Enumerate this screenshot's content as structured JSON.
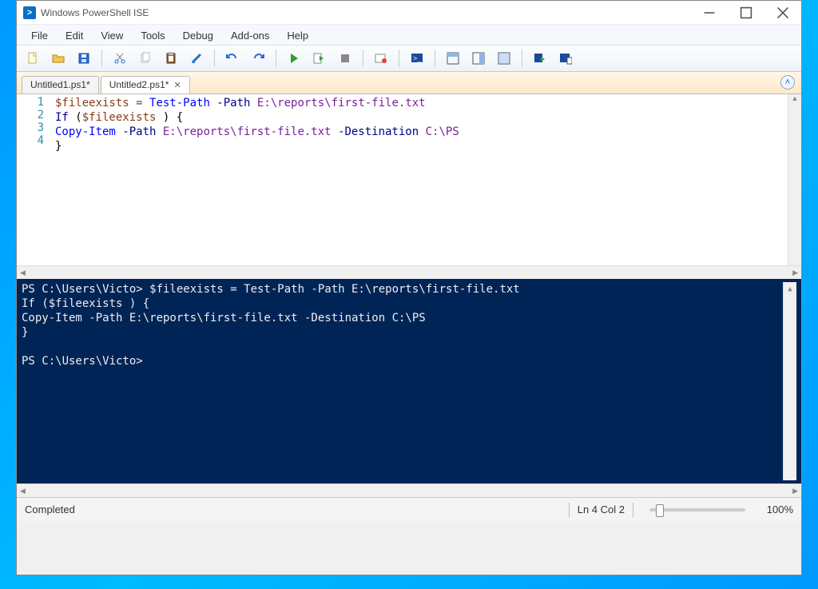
{
  "titlebar": {
    "title": "Windows PowerShell ISE"
  },
  "menus": [
    "File",
    "Edit",
    "View",
    "Tools",
    "Debug",
    "Add-ons",
    "Help"
  ],
  "toolbar_icons": [
    "new-file-icon",
    "open-file-icon",
    "save-icon",
    "sep",
    "cut-icon",
    "copy-icon",
    "paste-icon",
    "clear-icon",
    "sep",
    "undo-icon",
    "redo-icon",
    "sep",
    "run-script-icon",
    "run-selection-icon",
    "stop-icon",
    "sep",
    "breakpoint-icon",
    "sep",
    "new-remote-tab-icon",
    "sep",
    "show-script-top-icon",
    "show-script-right-icon",
    "show-script-max-icon",
    "sep",
    "show-commands-icon",
    "show-command-window-icon"
  ],
  "tabs": [
    {
      "label": "Untitled1.ps1*",
      "active": false
    },
    {
      "label": "Untitled2.ps1*",
      "active": true
    }
  ],
  "editor": {
    "line_numbers": [
      "1",
      "2",
      "3",
      "4"
    ],
    "tokens": [
      [
        {
          "t": "$fileexists",
          "c": "tok-var"
        },
        {
          "t": " = ",
          "c": "tok-op"
        },
        {
          "t": "Test-Path",
          "c": "tok-cmd"
        },
        {
          "t": " -Path ",
          "c": "tok-param"
        },
        {
          "t": "E:\\reports\\first-file.txt",
          "c": "tok-str"
        }
      ],
      [
        {
          "t": "If",
          "c": "tok-kw"
        },
        {
          "t": " (",
          "c": "tok-brace"
        },
        {
          "t": "$fileexists",
          "c": "tok-var"
        },
        {
          "t": " ) {",
          "c": "tok-brace"
        }
      ],
      [
        {
          "t": "Copy-Item",
          "c": "tok-cmd"
        },
        {
          "t": " -Path ",
          "c": "tok-param"
        },
        {
          "t": "E:\\reports\\first-file.txt",
          "c": "tok-str"
        },
        {
          "t": " -Destination ",
          "c": "tok-param"
        },
        {
          "t": "C:\\PS",
          "c": "tok-str"
        }
      ],
      [
        {
          "t": "}",
          "c": "tok-brace"
        }
      ]
    ]
  },
  "console": {
    "text": "PS C:\\Users\\Victo> $fileexists = Test-Path -Path E:\\reports\\first-file.txt\nIf ($fileexists ) {\nCopy-Item -Path E:\\reports\\first-file.txt -Destination C:\\PS\n}\n\nPS C:\\Users\\Victo>"
  },
  "status": {
    "state": "Completed",
    "position": "Ln 4  Col 2",
    "zoom": "100%"
  }
}
